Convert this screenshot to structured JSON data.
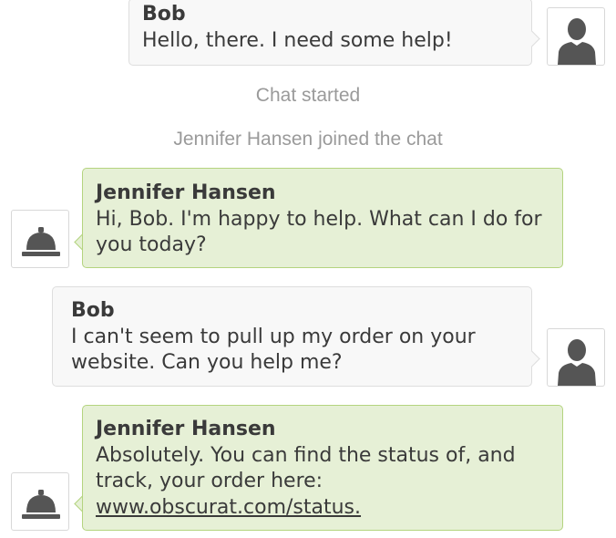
{
  "transcript": {
    "messages": [
      {
        "sender": "Bob",
        "text": "Hello, there.  I need some help!"
      },
      {
        "sender": "Jennifer Hansen",
        "text": "Hi, Bob.  I'm happy to help.  What can I do for you today?"
      },
      {
        "sender": "Bob",
        "text": "I can't seem to pull up my order on your website.  Can you help me?"
      },
      {
        "sender": "Jennifer Hansen",
        "text": "Absolutely.  You can find the status of, and track, your order here:",
        "link": "www.obscurat.com/status."
      }
    ],
    "events": [
      "Chat started",
      "Jennifer Hansen joined the chat"
    ]
  },
  "colors": {
    "agent_bubble": "#e6f0d6",
    "agent_border": "#b4d47f",
    "visitor_bubble": "#f8f8f8",
    "visitor_border": "#dedede",
    "system_text": "#9a9a9a"
  },
  "icons": {
    "visitor_avatar": "person-silhouette-icon",
    "agent_avatar": "service-bell-icon"
  }
}
